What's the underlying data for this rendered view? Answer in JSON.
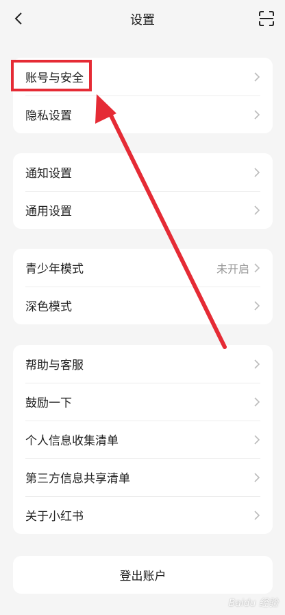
{
  "header": {
    "title": "设置"
  },
  "groups": [
    {
      "items": [
        {
          "label": "账号与安全"
        },
        {
          "label": "隐私设置"
        }
      ]
    },
    {
      "items": [
        {
          "label": "通知设置"
        },
        {
          "label": "通用设置"
        }
      ]
    },
    {
      "items": [
        {
          "label": "青少年模式",
          "value": "未开启"
        },
        {
          "label": "深色模式"
        }
      ]
    },
    {
      "items": [
        {
          "label": "帮助与客服"
        },
        {
          "label": "鼓励一下"
        },
        {
          "label": "个人信息收集清单"
        },
        {
          "label": "第三方信息共享清单"
        },
        {
          "label": "关于小红书"
        }
      ]
    }
  ],
  "logout": {
    "label": "登出账户"
  },
  "annotation": {
    "color": "#e52b35"
  },
  "watermark": {
    "text": "Baidu 经验"
  }
}
